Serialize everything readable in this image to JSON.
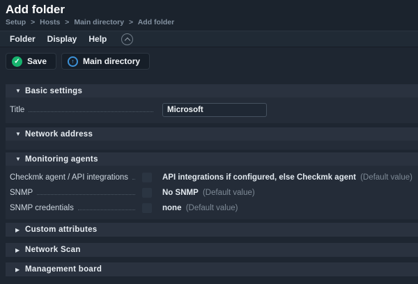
{
  "header": {
    "title": "Add folder",
    "breadcrumb_parts": [
      "Setup",
      "Hosts",
      "Main directory",
      "Add folder"
    ],
    "breadcrumb_separator": ">"
  },
  "menubar": {
    "items": [
      {
        "label": "Folder"
      },
      {
        "label": "Display"
      },
      {
        "label": "Help"
      }
    ],
    "collapse_icon": "chevron-up-circle"
  },
  "actions": {
    "save_label": "Save",
    "main_directory_label": "Main directory"
  },
  "glyphs": {
    "expanded_triangle": "▼",
    "collapsed_triangle": "▶",
    "check": "✓",
    "up_arrow": "↑"
  },
  "colors": {
    "accent_green": "#17b36e",
    "accent_blue": "#3d92d8"
  },
  "sections": {
    "basic_settings": {
      "title": "Basic settings",
      "expanded": true,
      "fields": [
        {
          "label": "Title",
          "value": "Microsoft"
        }
      ]
    },
    "network_address": {
      "title": "Network address",
      "expanded": true
    },
    "monitoring_agents": {
      "title": "Monitoring agents",
      "expanded": true,
      "rows": [
        {
          "label": "Checkmk agent / API integrations",
          "checkbox_checked": false,
          "value": "API integrations if configured, else Checkmk agent",
          "note": "(Default value)"
        },
        {
          "label": "SNMP",
          "checkbox_checked": false,
          "value": "No SNMP",
          "note": "(Default value)"
        },
        {
          "label": "SNMP credentials",
          "checkbox_checked": false,
          "value": "none",
          "note": "(Default value)"
        }
      ]
    },
    "custom_attributes": {
      "title": "Custom attributes",
      "expanded": false
    },
    "network_scan": {
      "title": "Network Scan",
      "expanded": false
    },
    "management_board": {
      "title": "Management board",
      "expanded": false
    }
  }
}
